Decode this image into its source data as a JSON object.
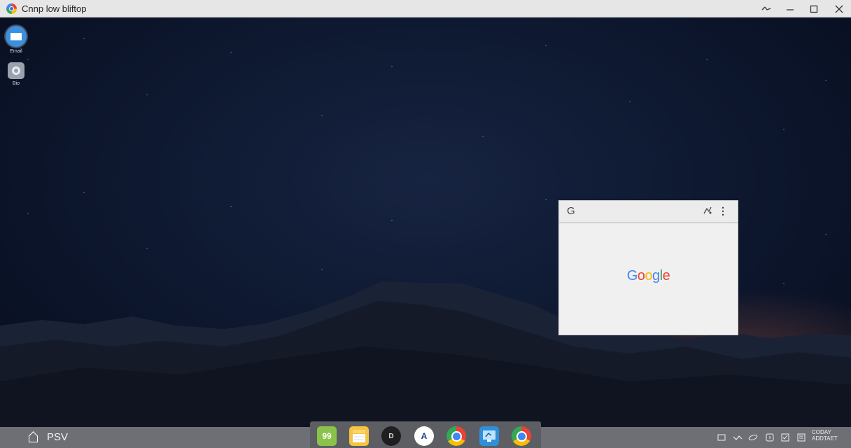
{
  "window": {
    "title": "Cnnp low bliftop",
    "controls": {
      "back": "back",
      "minimize": "minimize",
      "maximize": "maximize",
      "close": "close"
    }
  },
  "desktop_icons": [
    {
      "name": "mail",
      "label": "Email",
      "icon": "mail-icon"
    },
    {
      "name": "settings",
      "label": "Bio",
      "icon": "gear-icon"
    }
  ],
  "browser_popup": {
    "g_icon": "G",
    "ext_icon": "extension-icon",
    "more_icon": "⋮",
    "logo": [
      "G",
      "o",
      "o",
      "g",
      "l",
      "e"
    ],
    "logo_colors": [
      "#4285f4",
      "#ea4335",
      "#fbbc05",
      "#4285f4",
      "#34a853",
      "#ea4335"
    ]
  },
  "taskbar": {
    "left_label": "PSV",
    "dock": [
      {
        "name": "app-green",
        "glyph": "99",
        "color": "#8bc34a"
      },
      {
        "name": "notes",
        "glyph": "",
        "color": "#f6c443"
      },
      {
        "name": "camera",
        "glyph": "D",
        "color": "#1f1f1f"
      },
      {
        "name": "app-store",
        "glyph": "A",
        "color": "#ffffff"
      },
      {
        "name": "chrome",
        "glyph": "",
        "color": ""
      },
      {
        "name": "screen-app",
        "glyph": "",
        "color": "#2f8fd8"
      },
      {
        "name": "chrome-2",
        "glyph": "",
        "color": ""
      }
    ],
    "clock": {
      "line1": "CODAY",
      "line2": "ADDTAET"
    }
  }
}
